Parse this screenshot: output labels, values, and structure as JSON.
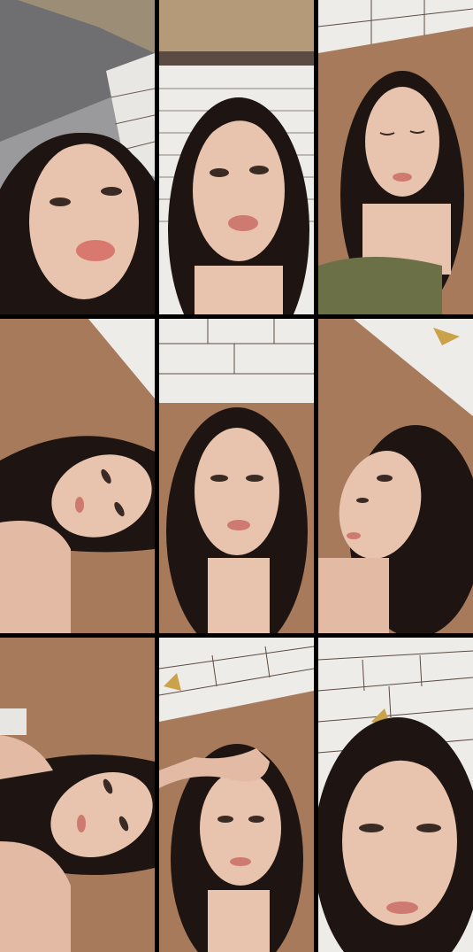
{
  "collage": {
    "layout": "3x3 grid",
    "tiles": [
      {
        "scene": "selfie-pout",
        "bg": "grey-ceiling"
      },
      {
        "scene": "selfie-pout",
        "bg": "white-brick"
      },
      {
        "scene": "eyes-closed-green-top",
        "bg": "wood-brick"
      },
      {
        "scene": "lying-down-tilted",
        "bg": "wood-floor"
      },
      {
        "scene": "selfie-centered",
        "bg": "brick-wood"
      },
      {
        "scene": "lying-down-side",
        "bg": "wood-floor"
      },
      {
        "scene": "lying-down-smile",
        "bg": "wood-floor"
      },
      {
        "scene": "hand-on-head",
        "bg": "brick-wood"
      },
      {
        "scene": "close-up-smile",
        "bg": "white-brick"
      }
    ]
  },
  "colors": {
    "gutter": "#000000",
    "skin": "#e8c3ad",
    "hair": "#1e1512",
    "brick": "#eeece8",
    "mortar": "#5c4b42",
    "wood": "#a87a5c",
    "green_top": "#6b7046"
  }
}
